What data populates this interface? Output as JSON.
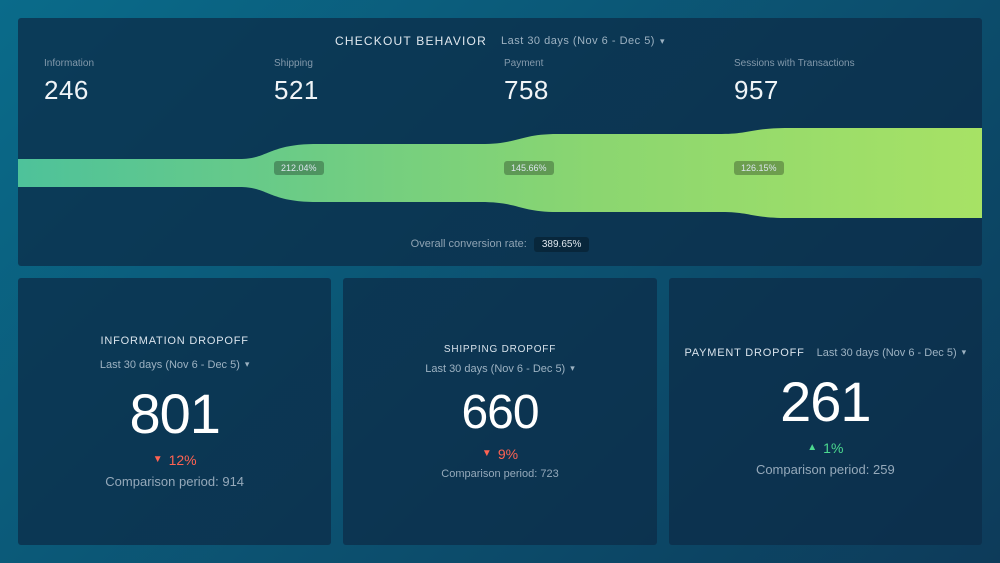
{
  "top": {
    "title": "CHECKOUT BEHAVIOR",
    "period": "Last 30 days (Nov 6 - Dec 5)",
    "overall_label": "Overall conversion rate:",
    "overall_value": "389.65%"
  },
  "stages": [
    {
      "label": "Information",
      "value": "246",
      "pct": ""
    },
    {
      "label": "Shipping",
      "value": "521",
      "pct": "212.04%"
    },
    {
      "label": "Payment",
      "value": "758",
      "pct": "145.66%"
    },
    {
      "label": "Sessions with Transactions",
      "value": "957",
      "pct": "126.15%"
    }
  ],
  "cards": [
    {
      "title": "INFORMATION DROPOFF",
      "period": "Last 30 days (Nov 6 - Dec 5)",
      "value": "801",
      "change_dir": "down",
      "change_pct": "12%",
      "comparison": "Comparison period: 914"
    },
    {
      "title": "SHIPPING DROPOFF",
      "period": "Last 30 days (Nov 6 - Dec 5)",
      "value": "660",
      "change_dir": "down",
      "change_pct": "9%",
      "comparison": "Comparison period: 723"
    },
    {
      "title": "PAYMENT DROPOFF",
      "period": "Last 30 days (Nov 6 - Dec 5)",
      "value": "261",
      "change_dir": "up",
      "change_pct": "1%",
      "comparison": "Comparison period: 259"
    }
  ],
  "chart_data": {
    "type": "area",
    "title": "Checkout Behavior Funnel",
    "categories": [
      "Information",
      "Shipping",
      "Payment",
      "Sessions with Transactions"
    ],
    "values": [
      246,
      521,
      758,
      957
    ],
    "step_conversion_pct": [
      null,
      212.04,
      145.66,
      126.15
    ],
    "overall_conversion_pct": 389.65,
    "ylim": [
      0,
      1000
    ]
  }
}
